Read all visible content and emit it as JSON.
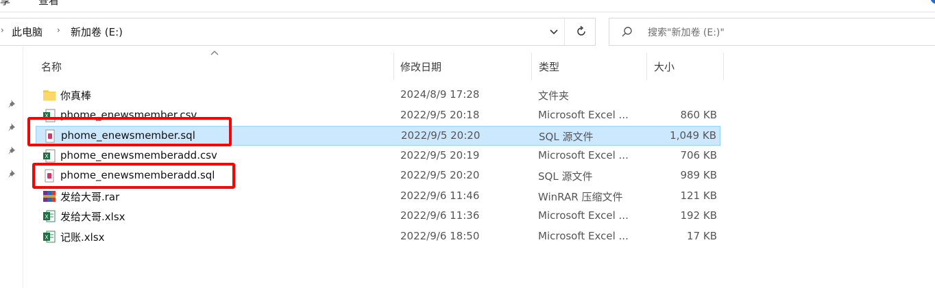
{
  "ribbon": {
    "share_label": "享",
    "view_label": "查看"
  },
  "address": {
    "crumbs": [
      "此电脑",
      "新加卷 (E:)"
    ]
  },
  "search": {
    "placeholder": "搜索\"新加卷 (E:)\""
  },
  "columns": {
    "name": "名称",
    "date": "修改日期",
    "type": "类型",
    "size": "大小"
  },
  "files": [
    {
      "name": "你真棒",
      "date": "2024/8/9 17:28",
      "type": "文件夹",
      "size": "",
      "icon": "folder-icon"
    },
    {
      "name": "phome_enewsmember.csv",
      "date": "2022/9/5 20:18",
      "type": "Microsoft Excel ...",
      "size": "860 KB",
      "icon": "csv-file-icon"
    },
    {
      "name": "phome_enewsmember.sql",
      "date": "2022/9/5 20:20",
      "type": "SQL 源文件",
      "size": "1,049 KB",
      "icon": "sql-file-icon"
    },
    {
      "name": "phome_enewsmemberadd.csv",
      "date": "2022/9/5 20:19",
      "type": "Microsoft Excel ...",
      "size": "706 KB",
      "icon": "csv-file-icon"
    },
    {
      "name": "phome_enewsmemberadd.sql",
      "date": "2022/9/5 20:20",
      "type": "SQL 源文件",
      "size": "989 KB",
      "icon": "sql-file-icon"
    },
    {
      "name": "发给大哥.rar",
      "date": "2022/9/6 11:46",
      "type": "WinRAR 压缩文件",
      "size": "121 KB",
      "icon": "rar-file-icon"
    },
    {
      "name": "发给大哥.xlsx",
      "date": "2022/9/6 11:36",
      "type": "Microsoft Excel ...",
      "size": "192 KB",
      "icon": "xlsx-file-icon"
    },
    {
      "name": "记账.xlsx",
      "date": "2022/9/6 18:50",
      "type": "Microsoft Excel ...",
      "size": "17 KB",
      "icon": "xlsx-file-icon"
    }
  ],
  "colors": {
    "selection": "#cce8ff",
    "highlight_box": "#ff0000",
    "folder": "#f8c94a"
  }
}
